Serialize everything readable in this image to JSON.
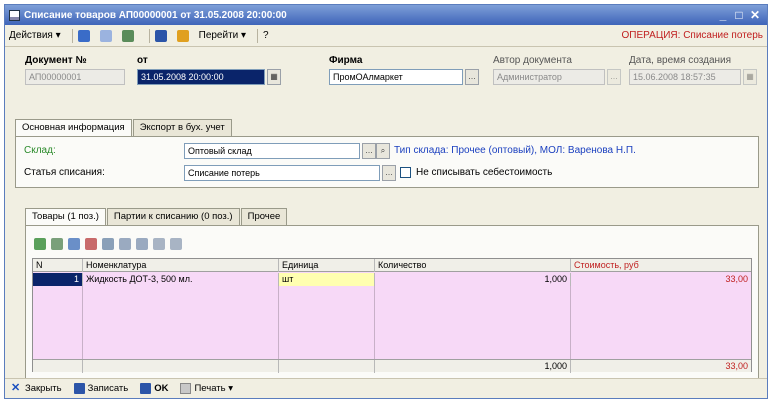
{
  "window": {
    "title": "Списание товаров АП00000001 от 31.05.2008 20:00:00",
    "min_glyph": "_",
    "close_glyph": "✕"
  },
  "toolbar": {
    "actions_label": "Действия ▾",
    "goto_label": "Перейти ▾",
    "help_label": "?",
    "operation_label": "ОПЕРАЦИЯ: Списание потерь"
  },
  "header": {
    "doc_no_label": "Документ №",
    "doc_no_value": "АП00000001",
    "date_label": "от",
    "date_value": "31.05.2008 20:00:00",
    "firm_label": "Фирма",
    "firm_value": "ПромОАлмаркет",
    "author_label": "Автор документа",
    "author_value": "Администратор",
    "created_label": "Дата, время создания",
    "created_value": "15.06.2008 18:57:35"
  },
  "tabs_top": {
    "main_info": "Основная информация",
    "export": "Экспорт в бух. учет"
  },
  "main_info": {
    "warehouse_label": "Склад:",
    "warehouse_value": "Оптовый склад",
    "warehouse_info": "Тип склада: Прочее (оптовый), МОЛ: Варенова Н.П.",
    "writeoff_label": "Статья списания:",
    "writeoff_value": "Списание потерь",
    "no_cost_label": "Не списывать себестоимость"
  },
  "tabs_bottom": {
    "goods": "Товары (1 поз.)",
    "batches": "Партии к списанию (0 поз.)",
    "other": "Прочее"
  },
  "table": {
    "columns": [
      "N",
      "Номенклатура",
      "Единица",
      "Количество",
      "Стоимость, руб"
    ],
    "rows": [
      {
        "n": "1",
        "item": "Жидкость ДОТ-3, 500 мл.",
        "unit": "шт",
        "qty": "1,000",
        "cost": "33,00"
      }
    ],
    "totals": {
      "qty": "1,000",
      "cost": "33,00"
    }
  },
  "statusbar": {
    "close": "Закрыть",
    "save": "Записать",
    "ok": "OK",
    "print": "Печать ▾"
  },
  "colors": {
    "title_bar": "#3e64b9",
    "grid_background": "#f7d9f7",
    "accent_red": "#c02020",
    "link_blue": "#1a3fbf"
  }
}
